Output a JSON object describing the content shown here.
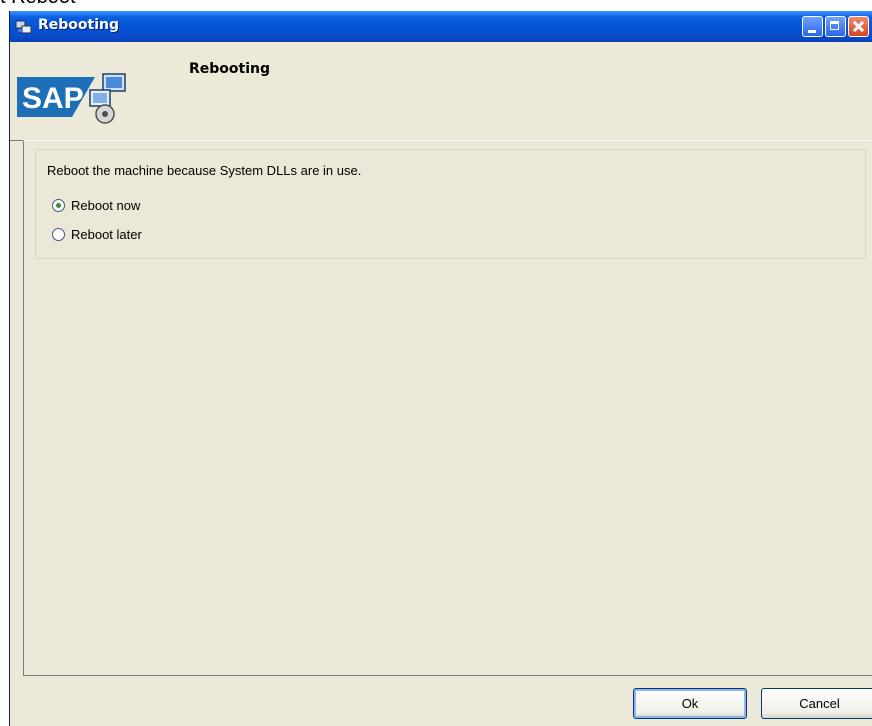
{
  "top_fragment": "t Reboot",
  "window": {
    "title": "Rebooting"
  },
  "header": {
    "title": "Rebooting",
    "logo_text": "SAP"
  },
  "group": {
    "message": "Reboot the machine because System DLLs are in use.",
    "options": [
      {
        "label": "Reboot now",
        "selected": true
      },
      {
        "label": "Reboot later",
        "selected": false
      }
    ]
  },
  "buttons": {
    "ok_label": "Ok",
    "cancel_label": "Cancel"
  },
  "colors": {
    "titlebar_blue": "#0552d6",
    "dialog_background": "#ece9d8",
    "radio_dot": "#3a8e3a"
  },
  "icons": [
    "installer-icon",
    "sap-logo",
    "minimize-icon",
    "maximize-icon",
    "close-icon"
  ]
}
